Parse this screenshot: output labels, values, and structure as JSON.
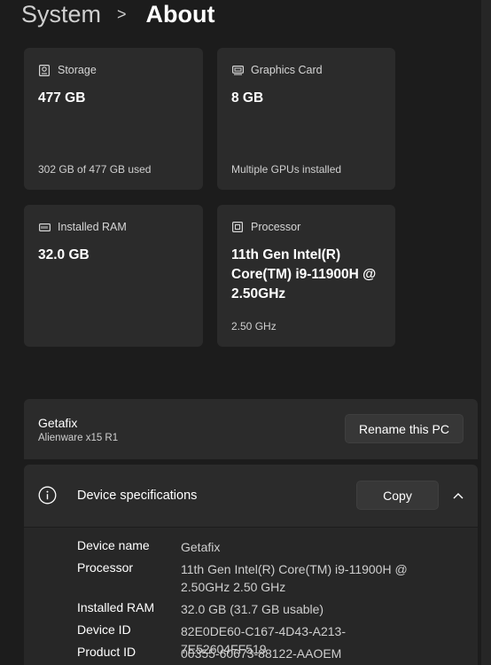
{
  "breadcrumb": {
    "parent": "System",
    "separator": ">",
    "current": "About"
  },
  "cards": {
    "storage": {
      "title": "Storage",
      "value": "477 GB",
      "sub": "302 GB of 477 GB used",
      "icon": "storage-icon"
    },
    "graphics": {
      "title": "Graphics Card",
      "value": "8 GB",
      "sub": "Multiple GPUs installed",
      "icon": "graphics-card-icon"
    },
    "ram": {
      "title": "Installed RAM",
      "value": "32.0 GB",
      "sub": "",
      "icon": "ram-icon"
    },
    "processor": {
      "title": "Processor",
      "value": "11th Gen Intel(R) Core(TM) i9-11900H @ 2.50GHz",
      "sub": "2.50 GHz",
      "icon": "processor-icon"
    }
  },
  "pc": {
    "name": "Getafix",
    "model": "Alienware x15 R1",
    "rename_label": "Rename this PC"
  },
  "device_specs": {
    "title": "Device specifications",
    "copy_label": "Copy",
    "rows": [
      {
        "label": "Device name",
        "value": "Getafix"
      },
      {
        "label": "Processor",
        "value": "11th Gen Intel(R) Core(TM) i9-11900H @ 2.50GHz   2.50 GHz"
      },
      {
        "label": "Installed RAM",
        "value": "32.0 GB (31.7 GB usable)"
      },
      {
        "label": "Device ID",
        "value": "82E0DE60-C167-4D43-A213-7E52604FF519"
      },
      {
        "label": "Product ID",
        "value": "00355-60673-88122-AAOEM"
      }
    ]
  },
  "colors": {
    "background": "#1c1c1c",
    "card": "#2b2b2b",
    "button": "#373737"
  }
}
